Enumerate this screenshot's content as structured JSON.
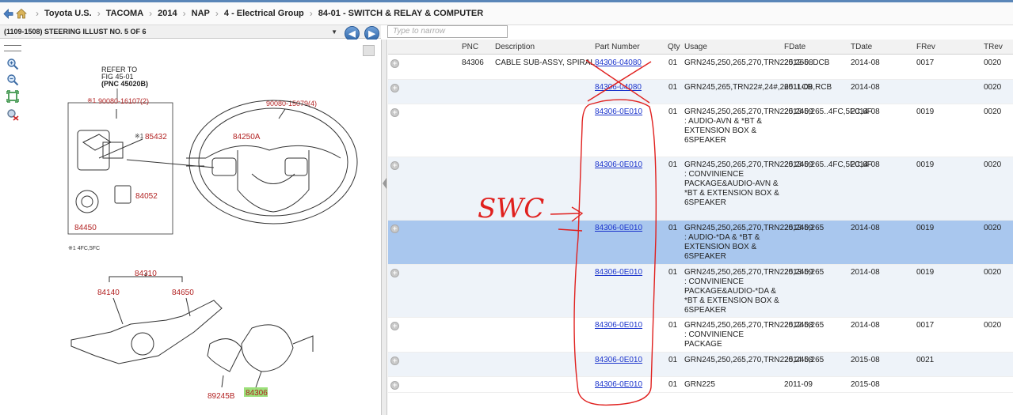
{
  "breadcrumb": [
    "Toyota U.S.",
    "TACOMA",
    "2014",
    "NAP",
    "4 - Electrical Group",
    "84-01 - SWITCH & RELAY & COMPUTER"
  ],
  "illustration": {
    "selector": "(1109-1508) STEERING ILLUST NO. 5 OF 6",
    "narrow_placeholder": "Type to narrow",
    "labels": {
      "refer_to": "REFER TO",
      "fig": "FIG 45-01",
      "pnc_ref": "(PNC  45020B)",
      "p1": "90080-16107(2)",
      "p2": "90080-15079(4)",
      "p3": "85432",
      "p4": "84250A",
      "p5": "84052",
      "p6": "84450",
      "note": "※1 4FC,5FC",
      "p7": "84310",
      "p8": "84140",
      "p9": "84650",
      "p10": "89245B",
      "p11": "84306",
      "mark": "※1"
    }
  },
  "table": {
    "headers": [
      "PNC",
      "Description",
      "Part Number",
      "Qty",
      "Usage",
      "FDate",
      "TDate",
      "FRev",
      "TRev"
    ],
    "rows": [
      {
        "pnc": "84306",
        "desc": "CABLE SUB-ASSY, SPIRAL",
        "pn": "84306-04080",
        "qty": "01",
        "usage": "GRN245,250,265,270,TRN225,265..DCB",
        "fdate": "2012-08",
        "tdate": "2014-08",
        "frev": "0017",
        "trev": "0020"
      },
      {
        "pnc": "",
        "desc": "",
        "pn": "84306-04080",
        "qty": "01",
        "usage": "GRN245,265,TRN22#,24#,265..LCB,RCB",
        "fdate": "2011-09",
        "tdate": "2014-08",
        "frev": "",
        "trev": "0020"
      },
      {
        "pnc": "",
        "desc": "",
        "pn": "84306-0E010",
        "qty": "01",
        "usage": "GRN245,250,265,270,TRN225,245,265..4FC,5FC,6F : AUDIO-AVN & *BT & EXTENSION BOX & 6SPEAKER",
        "fdate": "2013-09",
        "tdate": "2014-08",
        "frev": "0019",
        "trev": "0020"
      },
      {
        "pnc": "",
        "desc": "",
        "pn": "84306-0E010",
        "qty": "01",
        "usage": "GRN245,250,265,270,TRN225,245,265..4FC,5FC,6F : CONVINIENCE PACKAGE&AUDIO-AVN & *BT & EXTENSION BOX & 6SPEAKER",
        "fdate": "2013-09",
        "tdate": "2014-08",
        "frev": "0019",
        "trev": "0020"
      },
      {
        "pnc": "",
        "desc": "",
        "pn": "84306-0E010",
        "qty": "01",
        "usage": "GRN245,250,265,270,TRN225,245,265 : AUDIO-*DA & *BT & EXTENSION BOX & 6SPEAKER",
        "fdate": "2013-09",
        "tdate": "2014-08",
        "frev": "0019",
        "trev": "0020"
      },
      {
        "pnc": "",
        "desc": "",
        "pn": "84306-0E010",
        "qty": "01",
        "usage": "GRN245,250,265,270,TRN225,245,265 : CONVINIENCE PACKAGE&AUDIO-*DA & *BT & EXTENSION BOX & 6SPEAKER",
        "fdate": "2013-09",
        "tdate": "2014-08",
        "frev": "0019",
        "trev": "0020"
      },
      {
        "pnc": "",
        "desc": "",
        "pn": "84306-0E010",
        "qty": "01",
        "usage": "GRN245,250,265,270,TRN225,245,265 : CONVINIENCE PACKAGE",
        "fdate": "2012-08",
        "tdate": "2014-08",
        "frev": "0017",
        "trev": "0020"
      },
      {
        "pnc": "",
        "desc": "",
        "pn": "84306-0E010",
        "qty": "01",
        "usage": "GRN245,250,265,270,TRN225,245,265",
        "fdate": "2014-08",
        "tdate": "2015-08",
        "frev": "0021",
        "trev": ""
      },
      {
        "pnc": "",
        "desc": "",
        "pn": "84306-0E010",
        "qty": "01",
        "usage": "GRN225",
        "fdate": "2011-09",
        "tdate": "2015-08",
        "frev": "",
        "trev": ""
      }
    ]
  },
  "annotation": {
    "swc": "SWC"
  },
  "colors": {
    "accent": "#5a86b8",
    "selected_row": "#a9c7ee",
    "link": "#1a33cc",
    "markup": "#e0201e",
    "label_red": "#b22222"
  }
}
